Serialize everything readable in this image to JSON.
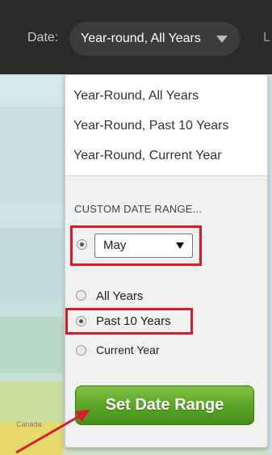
{
  "toolbar": {
    "date_label": "Date:",
    "date_value": "Year-round, All Years",
    "trailing_letter": "L"
  },
  "panel": {
    "presets": [
      "Year-Round, All Years",
      "Year-Round, Past 10 Years",
      "Year-Round, Current Year"
    ],
    "custom_heading": "CUSTOM DATE RANGE...",
    "month_value": "May",
    "year_options": [
      "All Years",
      "Past 10 Years",
      "Current Year"
    ],
    "selected_year_option": "Past 10 Years",
    "set_button": "Set Date Range"
  },
  "map": {
    "region_label": "Canada"
  },
  "colors": {
    "highlight": "#e0182d",
    "button_green": "#5aa325",
    "toolbar_bg": "#2b2b2b"
  }
}
